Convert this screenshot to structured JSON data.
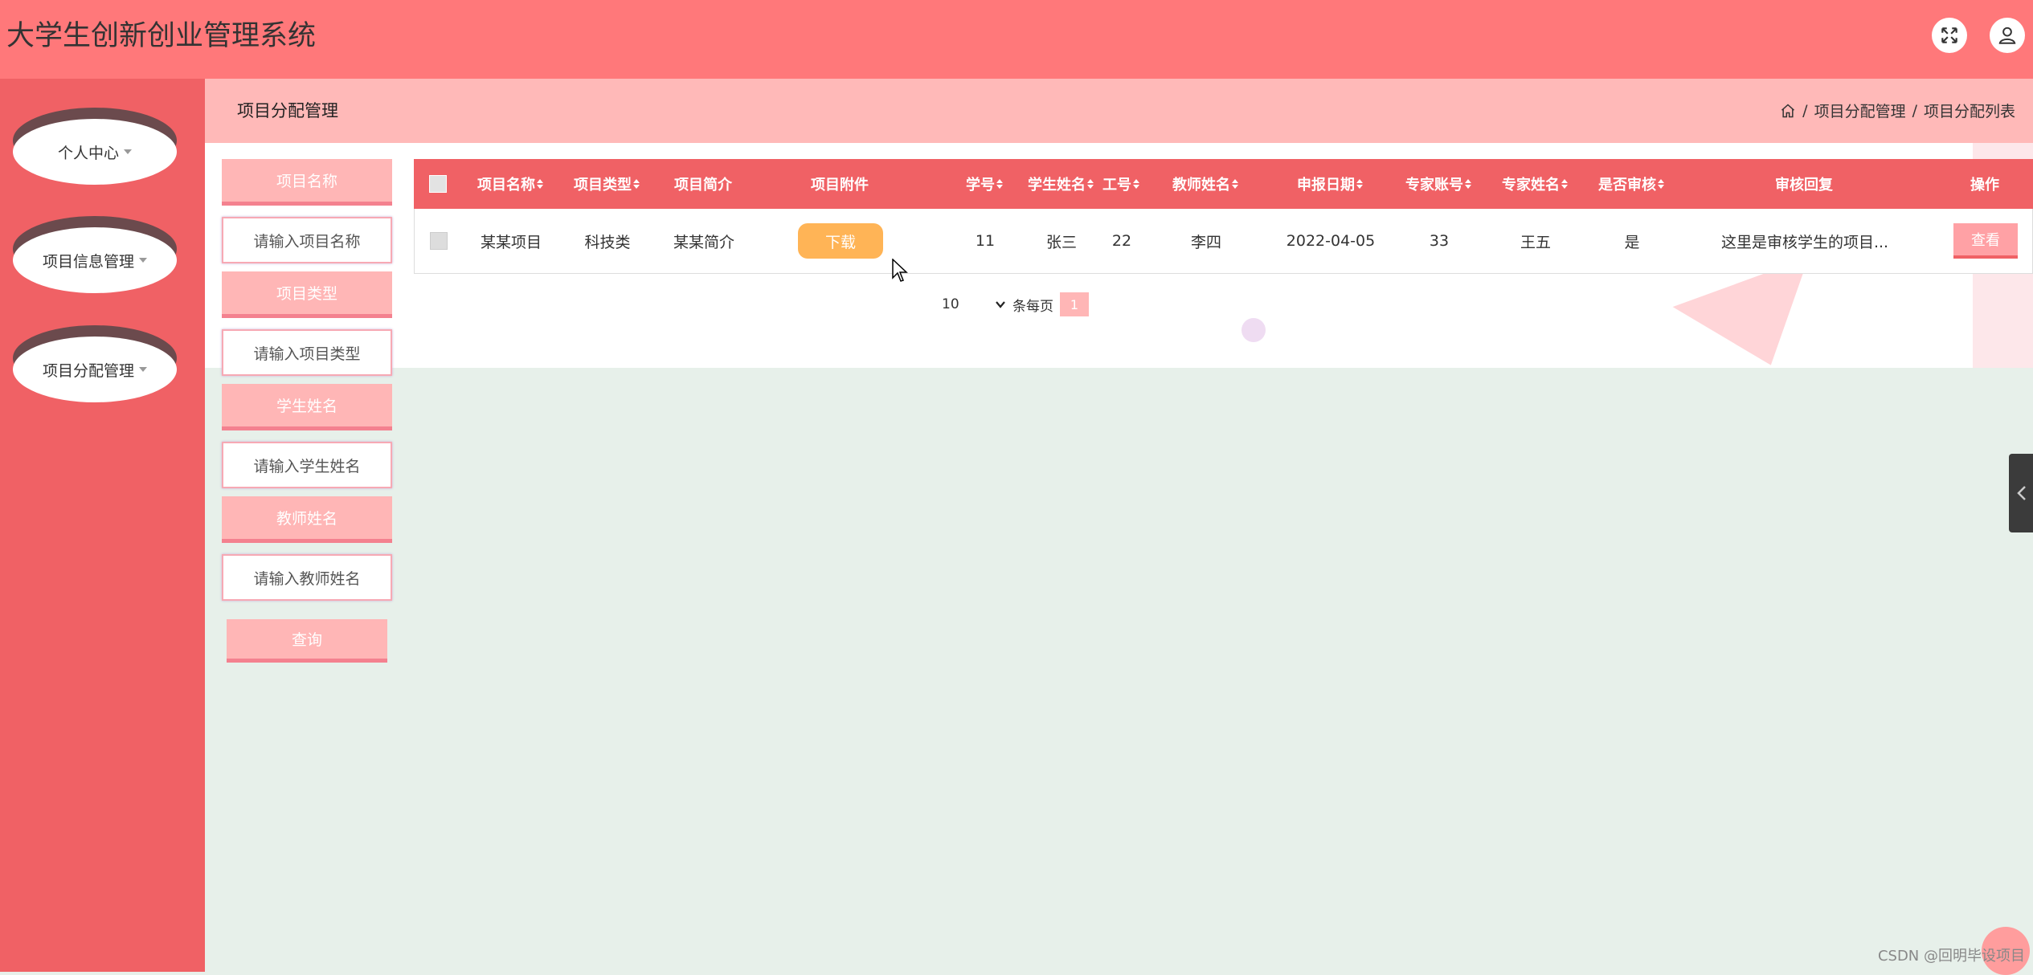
{
  "app": {
    "title": "大学生创新创业管理系统"
  },
  "header": {
    "fullscreen_icon": "expand-icon",
    "user_icon": "user-icon"
  },
  "sidebar": {
    "items": [
      {
        "label": "个人中心"
      },
      {
        "label": "项目信息管理"
      },
      {
        "label": "项目分配管理"
      }
    ]
  },
  "topbar": {
    "title": "项目分配管理",
    "breadcrumb": [
      "项目分配管理",
      "项目分配列表"
    ],
    "separator": "/"
  },
  "search": {
    "fields": [
      {
        "label": "项目名称",
        "placeholder": "请输入项目名称"
      },
      {
        "label": "项目类型",
        "placeholder": "请输入项目类型"
      },
      {
        "label": "学生姓名",
        "placeholder": "请输入学生姓名"
      },
      {
        "label": "教师姓名",
        "placeholder": "请输入教师姓名"
      }
    ],
    "submit_label": "查询"
  },
  "table": {
    "columns": [
      "项目名称",
      "项目类型",
      "项目简介",
      "项目附件",
      "学号",
      "学生姓名",
      "工号",
      "教师姓名",
      "申报日期",
      "专家账号",
      "专家姓名",
      "是否审核",
      "审核回复",
      "操作"
    ],
    "rows": [
      {
        "name": "某某项目",
        "type": "科技类",
        "intro": "某某简介",
        "attachment_label": "下载",
        "student_no": "11",
        "student_name": "张三",
        "staff_no": "22",
        "teacher_name": "李四",
        "date": "2022-04-05",
        "expert_account": "33",
        "expert_name": "王五",
        "reviewed": "是",
        "reply": "这里是审核学生的项目...",
        "action_label": "查看"
      }
    ]
  },
  "pagination": {
    "page_size": "10",
    "per_page_label": "条每页",
    "current_page": "1"
  },
  "watermark": "CSDN @回明毕设项目"
}
